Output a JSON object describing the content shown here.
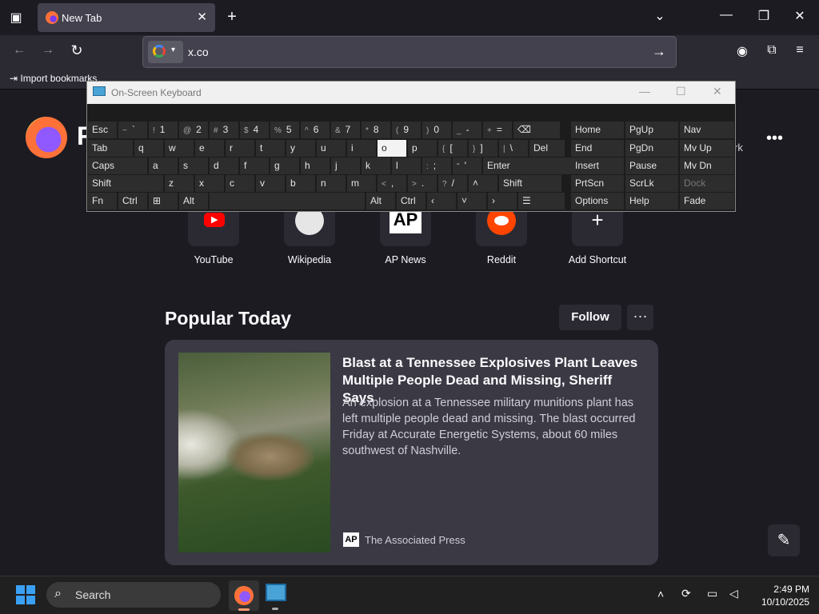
{
  "browser": {
    "tab_title": "New Tab",
    "url_value": "x.co",
    "bookmarks_import_label": "Import bookmarks",
    "logo_partial_text": "F",
    "partial_right_text": "rk"
  },
  "shortcuts": [
    {
      "label": "YouTube",
      "icon": "youtube-icon"
    },
    {
      "label": "Wikipedia",
      "icon": "wikipedia-icon"
    },
    {
      "label": "AP News",
      "icon": "ap-icon"
    },
    {
      "label": "Reddit",
      "icon": "reddit-icon"
    },
    {
      "label": "Add Shortcut",
      "icon": "plus-icon"
    }
  ],
  "popular": {
    "title": "Popular Today",
    "follow_label": "Follow",
    "story": {
      "headline": "Blast at a Tennessee Explosives Plant Leaves Multiple People Dead and Missing, Sheriff Says",
      "summary": "An explosion at a Tennessee military munitions plant has left multiple people dead and missing. The blast occurred Friday at Accurate Energetic Systems, about 60 miles southwest of Nashville.",
      "source": "The Associated Press",
      "source_logo": "AP"
    }
  },
  "osk": {
    "title": "On-Screen Keyboard",
    "rows": [
      [
        [
          "Esc",
          ""
        ],
        [
          "`",
          "~"
        ],
        [
          "1",
          "!"
        ],
        [
          "2",
          "@"
        ],
        [
          "3",
          "#"
        ],
        [
          "4",
          "$"
        ],
        [
          "5",
          "%"
        ],
        [
          "6",
          "^"
        ],
        [
          "7",
          "&"
        ],
        [
          "8",
          "*"
        ],
        [
          "9",
          "("
        ],
        [
          "0",
          ")"
        ],
        [
          "-",
          "_"
        ],
        [
          "=",
          "+"
        ],
        [
          "⌫",
          ""
        ]
      ],
      [
        [
          "Tab",
          ""
        ],
        [
          "q",
          ""
        ],
        [
          "w",
          ""
        ],
        [
          "e",
          ""
        ],
        [
          "r",
          ""
        ],
        [
          "t",
          ""
        ],
        [
          "y",
          ""
        ],
        [
          "u",
          ""
        ],
        [
          "i",
          ""
        ],
        [
          "o",
          ""
        ],
        [
          "p",
          ""
        ],
        [
          "[",
          "{"
        ],
        [
          "]",
          "}"
        ],
        [
          "\\",
          "|"
        ],
        [
          "Del",
          ""
        ]
      ],
      [
        [
          "Caps",
          ""
        ],
        [
          "a",
          ""
        ],
        [
          "s",
          ""
        ],
        [
          "d",
          ""
        ],
        [
          "f",
          ""
        ],
        [
          "g",
          ""
        ],
        [
          "h",
          ""
        ],
        [
          "j",
          ""
        ],
        [
          "k",
          ""
        ],
        [
          "l",
          ""
        ],
        [
          ";",
          ":"
        ],
        [
          "'",
          "\""
        ],
        [
          "Enter",
          ""
        ]
      ],
      [
        [
          "Shift",
          ""
        ],
        [
          "z",
          ""
        ],
        [
          "x",
          ""
        ],
        [
          "c",
          ""
        ],
        [
          "v",
          ""
        ],
        [
          "b",
          ""
        ],
        [
          "n",
          ""
        ],
        [
          "m",
          ""
        ],
        [
          ",",
          "<"
        ],
        [
          ".",
          ">"
        ],
        [
          "/",
          "?"
        ],
        [
          "˄",
          ""
        ],
        [
          "Shift",
          ""
        ]
      ],
      [
        [
          "Fn",
          ""
        ],
        [
          "Ctrl",
          ""
        ],
        [
          "⊞",
          ""
        ],
        [
          "Alt",
          ""
        ],
        [
          "",
          ""
        ],
        [
          "Alt",
          ""
        ],
        [
          "Ctrl",
          ""
        ],
        [
          "‹",
          ""
        ],
        [
          "˅",
          ""
        ],
        [
          "›",
          ""
        ],
        [
          "☰",
          ""
        ]
      ]
    ],
    "nav_keys": [
      [
        "Home",
        "PgUp",
        "Nav"
      ],
      [
        "End",
        "PgDn",
        "Mv Up"
      ],
      [
        "Insert",
        "Pause",
        "Mv Dn"
      ],
      [
        "PrtScn",
        "ScrLk",
        "Dock"
      ],
      [
        "Options",
        "Help",
        "Fade"
      ]
    ],
    "highlighted_key": "o"
  },
  "taskbar": {
    "search_label": "Search",
    "time": "2:49 PM",
    "date": "10/10/2025"
  }
}
